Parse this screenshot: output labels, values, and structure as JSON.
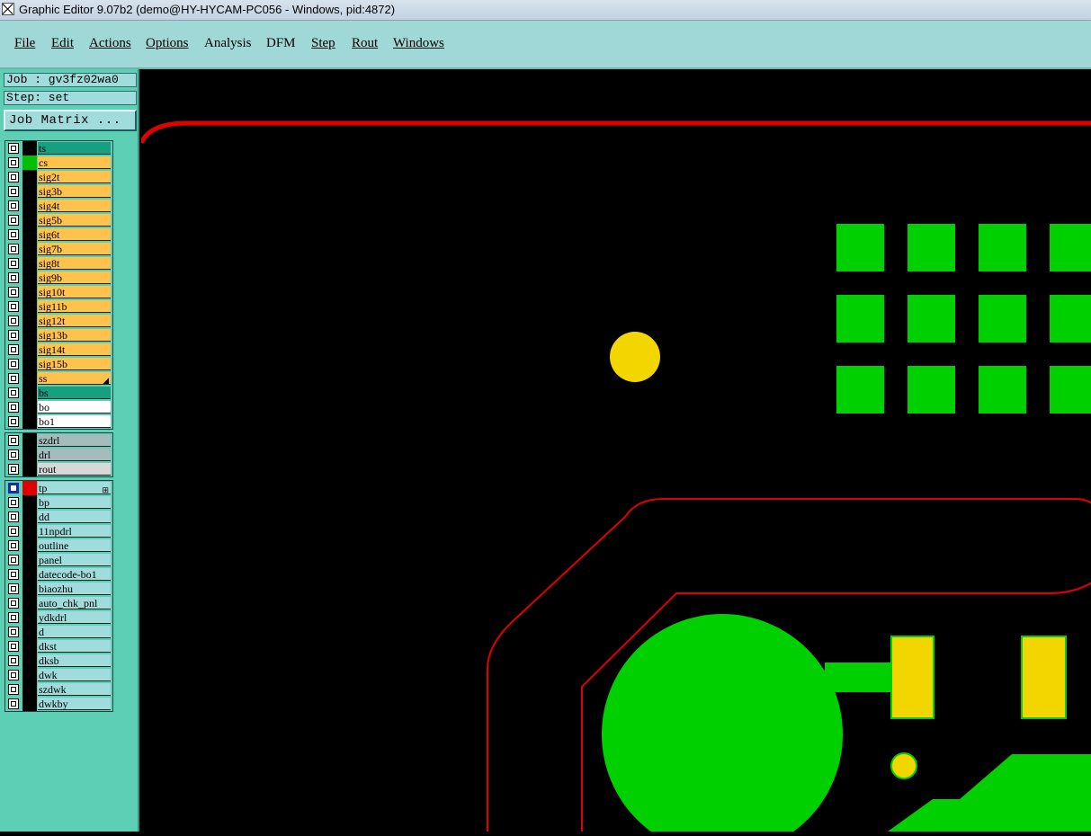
{
  "title": "Graphic Editor 9.07b2 (demo@HY-HYCAM-PC056 - Windows, pid:4872)",
  "menu": [
    {
      "label": "File"
    },
    {
      "label": "Edit"
    },
    {
      "label": "Actions"
    },
    {
      "label": "Options"
    },
    {
      "label": "Analysis"
    },
    {
      "label": "DFM"
    },
    {
      "label": "Step"
    },
    {
      "label": "Rout"
    },
    {
      "label": "Windows"
    }
  ],
  "job_label": "Job : gv3fz02wa0",
  "step_label": "Step: set",
  "job_matrix_label": "Job Matrix ...",
  "board_layers": [
    {
      "name": "ts",
      "type": "active"
    },
    {
      "name": "cs",
      "type": "board",
      "affected": true
    },
    {
      "name": "sig2t",
      "type": "board"
    },
    {
      "name": "sig3b",
      "type": "board"
    },
    {
      "name": "sig4t",
      "type": "board"
    },
    {
      "name": "sig5b",
      "type": "board"
    },
    {
      "name": "sig6t",
      "type": "board"
    },
    {
      "name": "sig7b",
      "type": "board"
    },
    {
      "name": "sig8t",
      "type": "board"
    },
    {
      "name": "sig9b",
      "type": "board"
    },
    {
      "name": "sig10t",
      "type": "board"
    },
    {
      "name": "sig11b",
      "type": "board"
    },
    {
      "name": "sig12t",
      "type": "board"
    },
    {
      "name": "sig13b",
      "type": "board"
    },
    {
      "name": "sig14t",
      "type": "board"
    },
    {
      "name": "sig15b",
      "type": "board"
    },
    {
      "name": "ss",
      "type": "board"
    },
    {
      "name": "bs",
      "type": "active"
    },
    {
      "name": "bo",
      "type": "white"
    },
    {
      "name": "bo1",
      "type": "white"
    }
  ],
  "drill_layers": [
    {
      "name": "szdrl",
      "type": "drill"
    },
    {
      "name": "drl",
      "type": "drill"
    },
    {
      "name": "rout",
      "type": "rout"
    }
  ],
  "misc_layers": [
    {
      "name": "tp",
      "type": "misc",
      "work": true
    },
    {
      "name": "bp",
      "type": "misc"
    },
    {
      "name": "dd",
      "type": "misc"
    },
    {
      "name": "11npdrl",
      "type": "misc"
    },
    {
      "name": "outline",
      "type": "misc"
    },
    {
      "name": "panel",
      "type": "misc"
    },
    {
      "name": "datecode-bo1",
      "type": "misc"
    },
    {
      "name": "biaozhu",
      "type": "misc"
    },
    {
      "name": "auto_chk_pnl",
      "type": "misc"
    },
    {
      "name": "ydkdrl",
      "type": "misc"
    },
    {
      "name": "d",
      "type": "misc"
    },
    {
      "name": "dkst",
      "type": "misc"
    },
    {
      "name": "dksb",
      "type": "misc"
    },
    {
      "name": "dwk",
      "type": "misc"
    },
    {
      "name": "szdwk",
      "type": "misc"
    },
    {
      "name": "dwkby",
      "type": "misc"
    }
  ],
  "colors": {
    "canvas": "#000000",
    "profile": "#e00000",
    "copper": "#00d000",
    "pad": "#f2d600"
  }
}
